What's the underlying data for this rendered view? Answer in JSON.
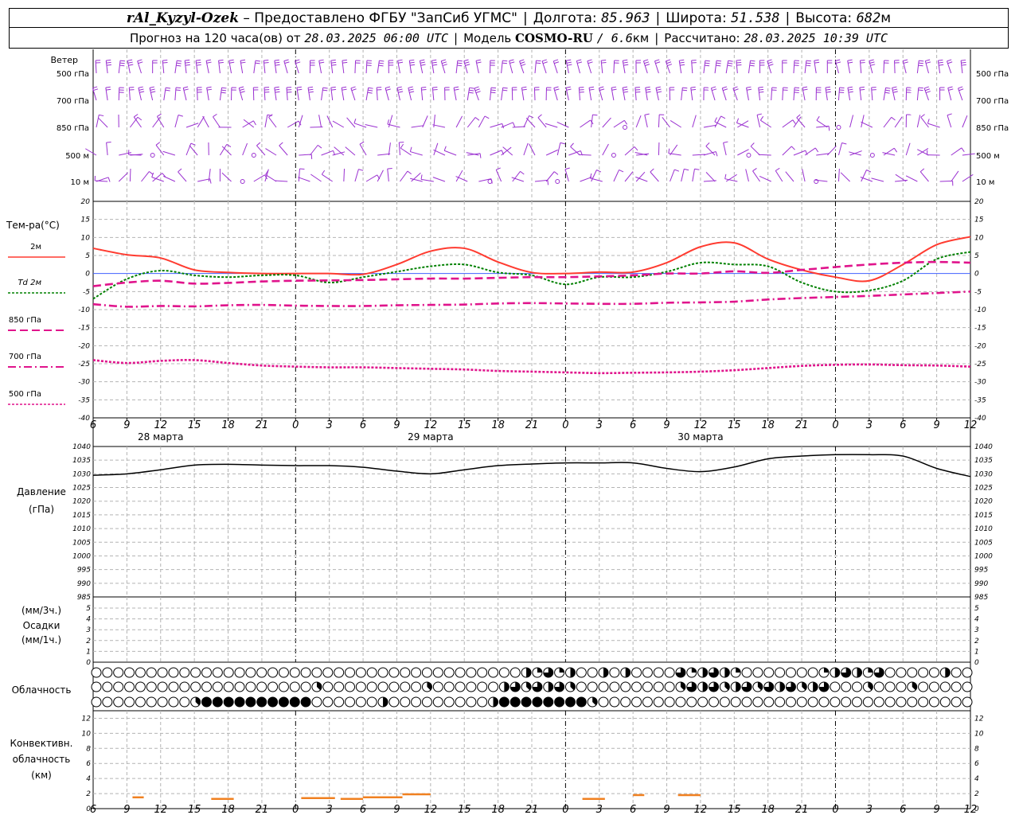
{
  "header": {
    "station": "rAl_Kyzyl-Ozek",
    "provider_prefix": "– Предоставлено ФГБУ",
    "provider_name": "\"ЗапСиб УГМС\"",
    "lon_label": "Долгота:",
    "lon_value": "85.963",
    "lat_label": "Широта:",
    "lat_value": "51.538",
    "alt_label": "Высота:",
    "alt_value": "682",
    "alt_unit": "м",
    "forecast_label": "Прогноз на 120 часа(ов) от",
    "forecast_time": "28.03.2025 06:00 UTC",
    "model_label": "Модель",
    "model_name": "COSMO-RU",
    "model_res": "/ 6.6",
    "model_res_unit": "км",
    "calc_label": "Рассчитано:",
    "calc_time": "28.03.2025 10:39 UTC"
  },
  "wind_panel": {
    "title": "Ветер",
    "levels": [
      "500 гПа",
      "700 гПа",
      "850 гПа",
      "500 м",
      "10  м"
    ],
    "barb_color": "#9a30d0"
  },
  "temp_panel": {
    "ylabel": "Тем-ра(°C)",
    "legend": [
      "2м",
      "Td  2м",
      "850 гПа",
      "700 гПа",
      "500 гПа"
    ],
    "ylim": [
      -40,
      20
    ],
    "ticks": [
      20,
      15,
      10,
      5,
      0,
      -5,
      -10,
      -15,
      -20,
      -25,
      -30,
      -35,
      -40
    ]
  },
  "pressure_panel": {
    "ylabel1": "Давление",
    "ylabel2": "(гПа)",
    "ylim": [
      985,
      1040
    ],
    "ticks": [
      1040,
      1035,
      1030,
      1025,
      1020,
      1015,
      1010,
      1005,
      1000,
      995,
      990,
      985
    ]
  },
  "precip_panel": {
    "ylabel1": "(мм/3ч.)",
    "ylabel2": "Осадки",
    "ylabel3": "(мм/1ч.)",
    "ylim": [
      0,
      5
    ],
    "ticks": [
      5,
      4,
      3,
      2,
      1,
      0
    ]
  },
  "cloud_panel": {
    "label": "Облачность"
  },
  "conv_panel": {
    "ylabel1": "Конвективн.",
    "ylabel2": "облачность",
    "ylabel3": "(км)",
    "ylim": [
      0,
      13
    ],
    "ticks": [
      12,
      10,
      8,
      6,
      4,
      2,
      0
    ]
  },
  "x_axis": {
    "hour_labels": [
      "6",
      "9",
      "12",
      "15",
      "18",
      "21",
      "0",
      "3",
      "6",
      "9",
      "12",
      "15",
      "18",
      "21",
      "0",
      "3",
      "6",
      "9",
      "12",
      "15",
      "18",
      "21",
      "0",
      "3",
      "6",
      "9",
      "12"
    ],
    "dates": [
      "28 марта",
      "29 марта",
      "30 марта"
    ]
  },
  "colors": {
    "t2m": "#ff3b30",
    "td2m": "#008000",
    "t850": "#e0148c",
    "t700": "#e0148c",
    "t500": "#e0148c",
    "pressure": "#000000",
    "conv": "#f08020",
    "wind": "#9a30d0",
    "grid": "#b4b4b4"
  },
  "chart_data": [
    {
      "type": "line",
      "name": "temperature",
      "x_hours": [
        0,
        3,
        6,
        9,
        12,
        15,
        18,
        21,
        24,
        27,
        30,
        33,
        36,
        39,
        42,
        45,
        48,
        51,
        54,
        57,
        60,
        63,
        66,
        69,
        72,
        75,
        78
      ],
      "series": [
        {
          "name": "2м",
          "values": [
            7,
            5.2,
            4.3,
            1,
            0.3,
            0,
            0,
            0,
            -0.2,
            2.5,
            6.2,
            7,
            3.2,
            0.3,
            0,
            0.4,
            0.4,
            3,
            7.4,
            8.5,
            4,
            1,
            -1,
            -2,
            2.5,
            8,
            10.2
          ]
        },
        {
          "name": "Td  2м",
          "values": [
            -7,
            -1.5,
            0.8,
            -0.5,
            -1,
            -0.5,
            -0.5,
            -2.5,
            -1,
            0.5,
            2,
            2.5,
            0.3,
            -0.5,
            -3,
            -1,
            -1,
            0.5,
            3,
            2.5,
            2,
            -2.5,
            -5,
            -4.7,
            -2,
            4,
            6
          ]
        },
        {
          "name": "850 гПа",
          "values": [
            -3.5,
            -2.5,
            -2,
            -2.8,
            -2.6,
            -2.2,
            -2,
            -1.9,
            -1.8,
            -1.6,
            -1.4,
            -1.4,
            -1.2,
            -1,
            -1,
            -0.8,
            -0.5,
            0,
            0,
            0.6,
            0.2,
            1,
            1.8,
            2.5,
            3,
            3.2,
            3
          ]
        },
        {
          "name": "700 гПа",
          "values": [
            -8.5,
            -9.2,
            -9,
            -9.1,
            -8.8,
            -8.7,
            -8.9,
            -9,
            -9,
            -8.8,
            -8.7,
            -8.6,
            -8.3,
            -8.2,
            -8.3,
            -8.4,
            -8.4,
            -8.1,
            -8,
            -7.8,
            -7.2,
            -6.8,
            -6.5,
            -6.2,
            -5.8,
            -5.4,
            -5
          ]
        },
        {
          "name": "500 гПа",
          "values": [
            -24,
            -24.8,
            -24.2,
            -24,
            -24.8,
            -25.5,
            -25.8,
            -26,
            -26,
            -26.2,
            -26.4,
            -26.6,
            -27,
            -27.2,
            -27.4,
            -27.6,
            -27.5,
            -27.4,
            -27.2,
            -26.8,
            -26.2,
            -25.6,
            -25.3,
            -25.2,
            -25.4,
            -25.5,
            -25.8
          ]
        }
      ]
    },
    {
      "type": "line",
      "name": "pressure",
      "x_hours": [
        0,
        3,
        6,
        9,
        12,
        15,
        18,
        21,
        24,
        27,
        30,
        33,
        36,
        39,
        42,
        45,
        48,
        51,
        54,
        57,
        60,
        63,
        66,
        69,
        72,
        75,
        78
      ],
      "series": [
        {
          "name": "Давление",
          "values": [
            1029.5,
            1030,
            1031.5,
            1033.2,
            1033.5,
            1033.2,
            1033,
            1033,
            1032.4,
            1031,
            1030,
            1031.5,
            1033,
            1033.6,
            1034,
            1034,
            1034,
            1032,
            1030.8,
            1032.5,
            1035.5,
            1036.5,
            1037,
            1037,
            1036.5,
            1032,
            1029
          ]
        }
      ]
    },
    {
      "type": "bar",
      "name": "convective_cloud",
      "segments_hours": [
        [
          3.5,
          4.5
        ],
        [
          10.5,
          12.5
        ],
        [
          18.5,
          21.5
        ],
        [
          22,
          24
        ],
        [
          24,
          27.5
        ],
        [
          27.5,
          30
        ],
        [
          43.5,
          45.5
        ],
        [
          48,
          49
        ],
        [
          52,
          54
        ]
      ],
      "values_km": [
        1.5,
        1.3,
        1.4,
        1.3,
        1.5,
        1.9,
        1.3,
        1.8,
        1.8
      ]
    }
  ]
}
